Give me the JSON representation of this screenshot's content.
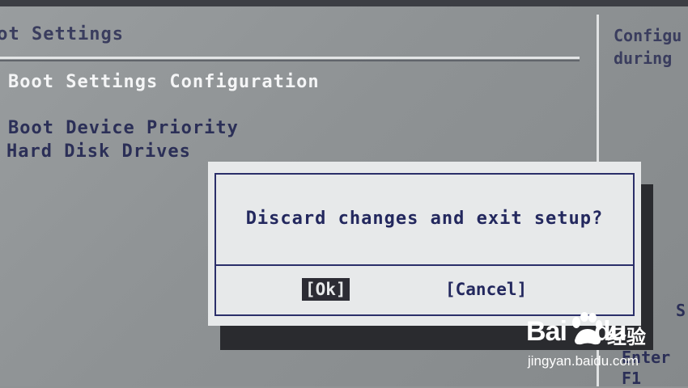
{
  "header": {
    "section_title": "oot Settings"
  },
  "help_panel": {
    "text": "Configu\nduring"
  },
  "menu": {
    "items": [
      {
        "label": "Boot Settings Configuration"
      },
      {
        "label": "Boot Device Priority"
      },
      {
        "label": "Hard Disk Drives"
      }
    ]
  },
  "right_keys": {
    "k1": "S",
    "k2": "Enter",
    "k3": "F1"
  },
  "dialog": {
    "message": "Discard changes and exit setup?",
    "ok_label": "[Ok]",
    "cancel_label": "[Cancel]"
  },
  "watermark": {
    "logo": "Bai",
    "logo_suffix": "du",
    "cn": "经验",
    "url": "jingyan.baidu.com"
  },
  "colors": {
    "bios_bg": "#8f9394",
    "text": "#2b2f57",
    "dialog_bg": "#e7e9ea",
    "dialog_border": "#2b2f6a"
  }
}
